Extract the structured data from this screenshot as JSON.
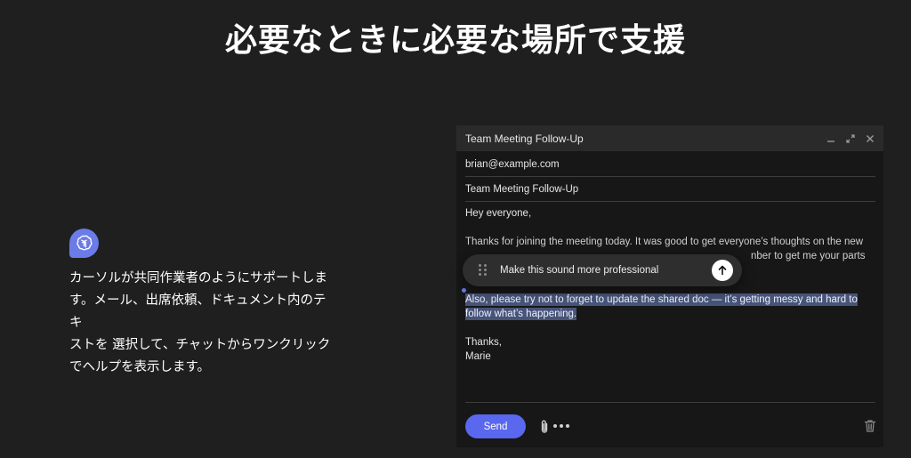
{
  "headline": "必要なときに必要な場所で支援",
  "promo": {
    "logo_icon": "chatgpt-logo-icon",
    "lines": [
      "カーソルが共同作業者のようにサポートしま",
      "す。メール、出席依頼、ドキュメント内のテキ",
      "ストを 選択して、チャットからワンクリック",
      "でヘルプを表示します。"
    ]
  },
  "compose": {
    "title": "Team Meeting Follow-Up",
    "controls": {
      "minimize": "minimize-icon",
      "expand": "expand-icon",
      "close": "close-icon"
    },
    "to": "brian@example.com",
    "subject": "Team Meeting Follow-Up",
    "greeting": "Hey everyone,",
    "para1_line1": "Thanks for joining the meeting today. It was good to get everyone’s thoughts on the new",
    "para1_line2_end": "nber to get me your parts",
    "para2_line1": "Also, please try not to forget to update the shared doc — it’s getting messy and hard to",
    "para2_line2": "follow what’s happening.",
    "signoff_line1": "Thanks,",
    "signoff_line2": "Marie",
    "send_label": "Send"
  },
  "prompt": {
    "text": "Make this sound more professional",
    "submit_icon": "arrow-up-icon"
  },
  "colors": {
    "background": "#1f1f1f",
    "accent": "#5a67ef",
    "highlight": "#475478",
    "logo": "#6b7be8"
  }
}
